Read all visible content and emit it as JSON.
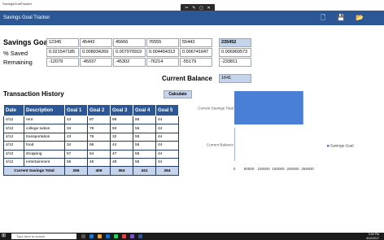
{
  "window": {
    "os_title": "SavingsGoalTracker",
    "title": "Savings Goal Tracker"
  },
  "toolbar": {
    "icons": [
      "new-icon",
      "save-icon",
      "open-icon"
    ]
  },
  "labels": {
    "savings_goal": "Savings Goal",
    "pct_saved": "% Saved",
    "remaining": "Remaining",
    "current_balance": "Current Balance",
    "transaction_history": "Transaction History",
    "calculate": "Calculate"
  },
  "goals": [
    "12345",
    "45443",
    "45666",
    "76555",
    "55443"
  ],
  "goal_total": "235452",
  "pct": [
    "0.021547185",
    "0.008934269",
    "0.007970919",
    "0.004454313",
    "0.006741647"
  ],
  "pct_total": "0.006969573",
  "remaining": [
    "-12079",
    "-45037",
    "-45302",
    "-76214",
    "-55179"
  ],
  "remaining_total": "-233811",
  "current_balance": "1641",
  "table": {
    "headers": [
      "Date",
      "Description",
      "Goal 1",
      "Goal 2",
      "Goal 3",
      "Goal 4",
      "Goal 5"
    ],
    "rows": [
      [
        "4/12",
        "rent",
        "43",
        "87",
        "99",
        "66",
        "44"
      ],
      [
        "4/12",
        "college tuition",
        "34",
        "78",
        "93",
        "55",
        "44"
      ],
      [
        "4/12",
        "transportation",
        "43",
        "76",
        "32",
        "55",
        "44"
      ],
      [
        "4/12",
        "food",
        "34",
        "66",
        "44",
        "55",
        "44"
      ],
      [
        "4/12",
        "shopping",
        "57",
        "54",
        "47",
        "55",
        "44"
      ],
      [
        "4/12",
        "entertainment",
        "55",
        "45",
        "49",
        "55",
        "44"
      ]
    ],
    "total_label": "Current Savings Total",
    "totals": [
      "266",
      "406",
      "364",
      "341",
      "264"
    ]
  },
  "chart_data": {
    "type": "bar",
    "orientation": "horizontal",
    "categories": [
      "Current Savings Total",
      "Current Balance"
    ],
    "series": [
      {
        "name": "Savings Goal",
        "values": [
          235452,
          1641
        ],
        "color": "#4a7fd6"
      }
    ],
    "x_ticks": [
      "0",
      "50000",
      "100000",
      "150000",
      "200000",
      "250000"
    ],
    "xlim": [
      0,
      250000
    ],
    "legend": "right"
  },
  "taskbar": {
    "search_placeholder": "Type here to search",
    "time": "3:45 PM",
    "date": "4/12/2017"
  }
}
